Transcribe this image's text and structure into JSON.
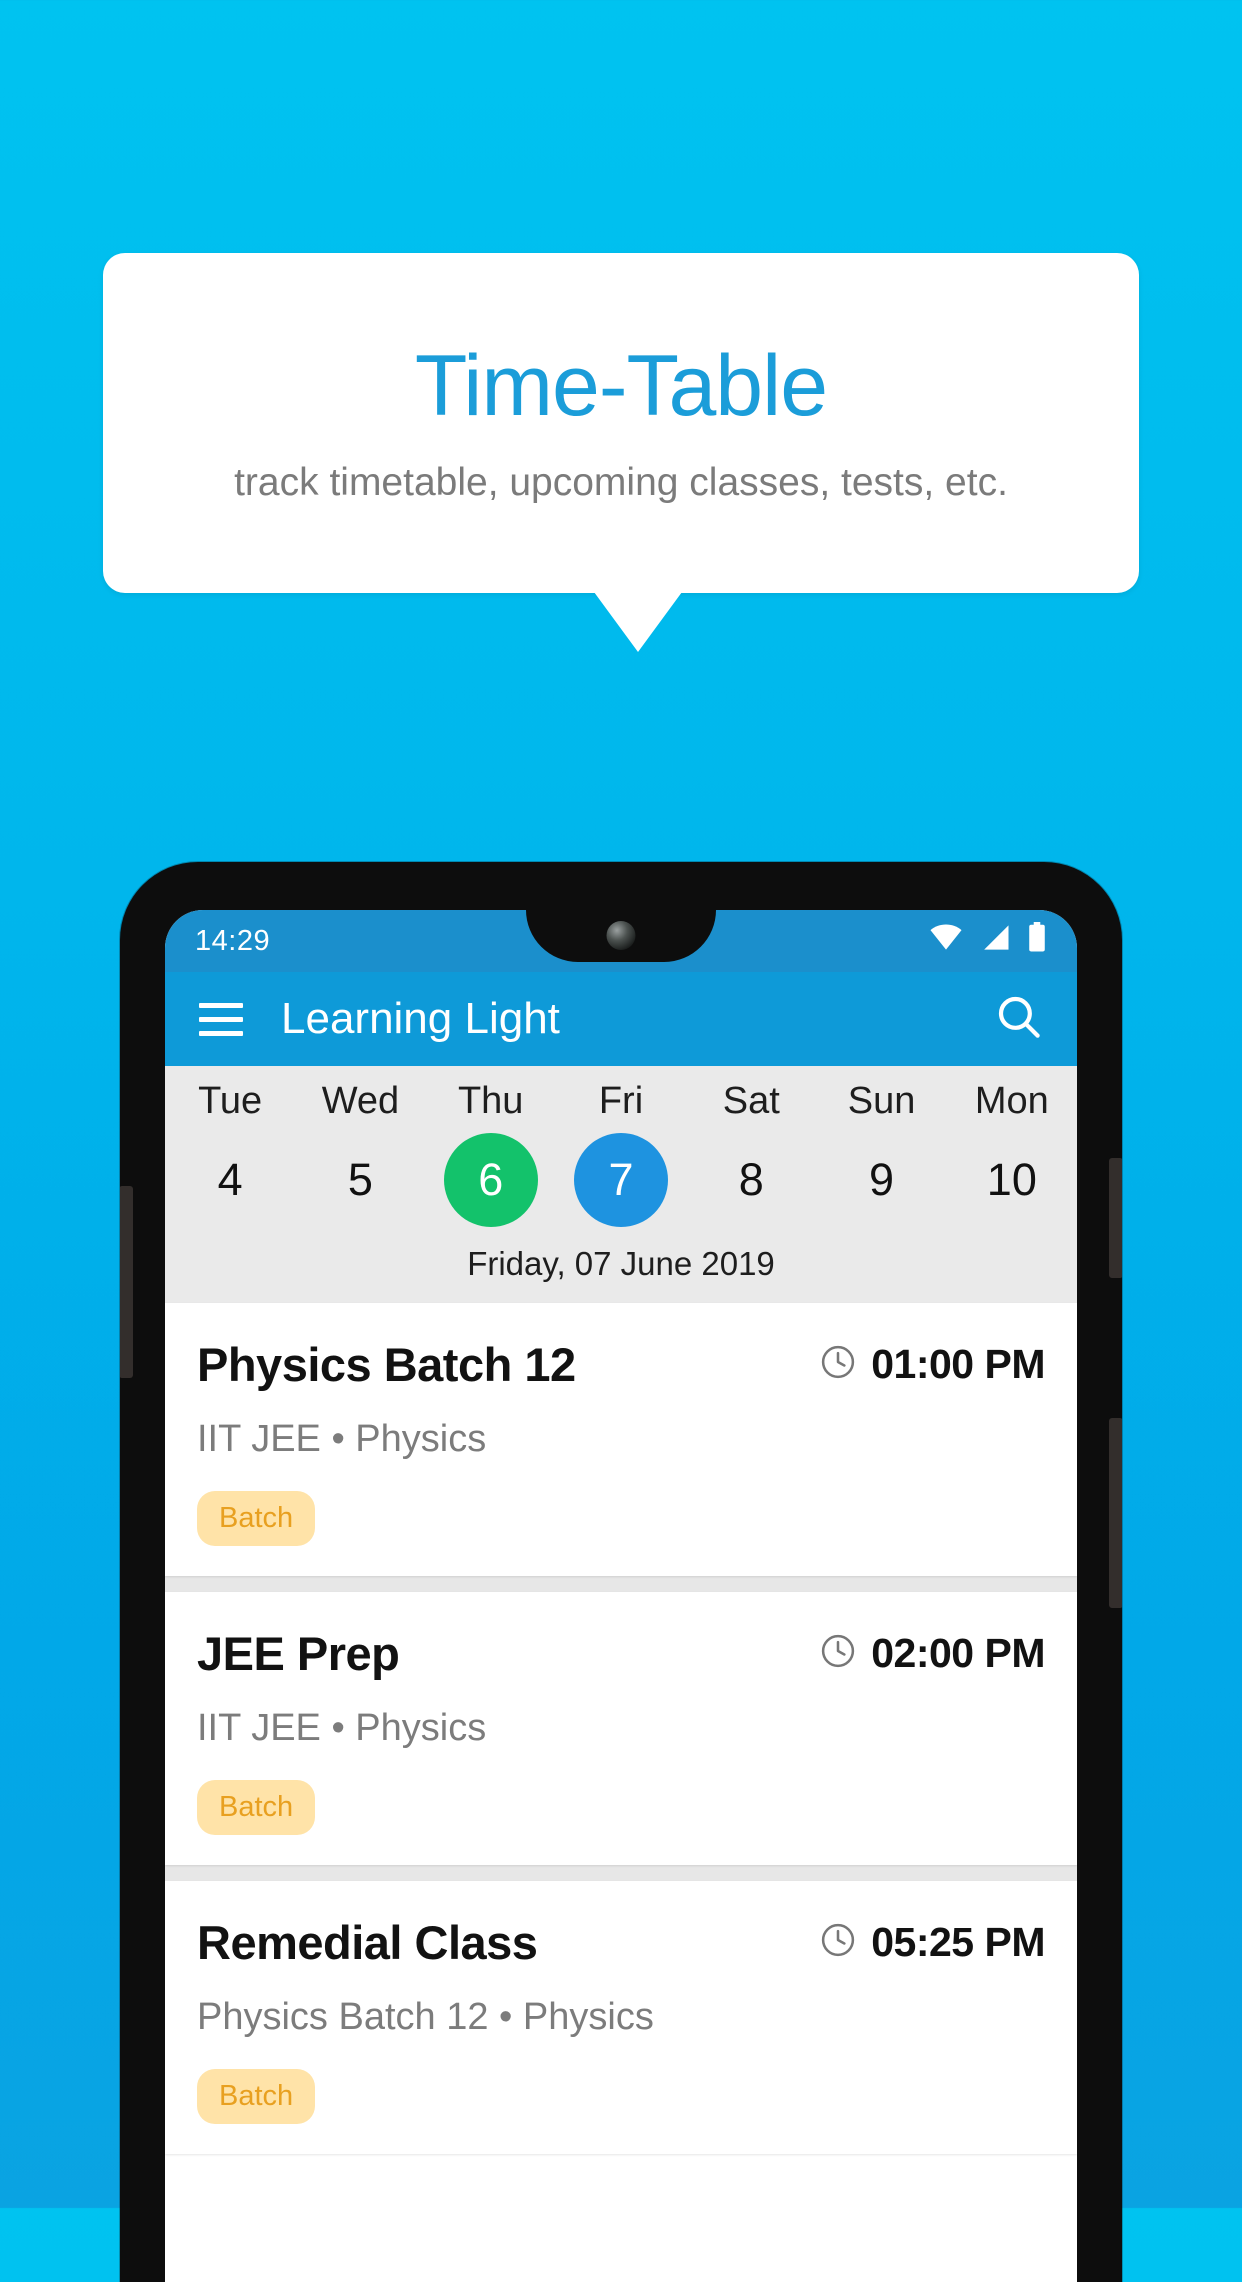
{
  "promo": {
    "title": "Time-Table",
    "subtitle": "track timetable, upcoming classes, tests, etc.",
    "title_color": "#1b9dd9",
    "background": "#00b6ec"
  },
  "phone": {
    "statusbar": {
      "time": "14:29",
      "icons": [
        "wifi-icon",
        "signal-icon",
        "battery-icon"
      ]
    },
    "appbar": {
      "menu_icon": "hamburger-menu-icon",
      "title": "Learning Light",
      "search_icon": "search-icon"
    },
    "datestrip": {
      "days": [
        {
          "name": "Tue",
          "num": "4",
          "state": "normal"
        },
        {
          "name": "Wed",
          "num": "5",
          "state": "normal"
        },
        {
          "name": "Thu",
          "num": "6",
          "state": "today"
        },
        {
          "name": "Fri",
          "num": "7",
          "state": "selected"
        },
        {
          "name": "Sat",
          "num": "8",
          "state": "normal"
        },
        {
          "name": "Sun",
          "num": "9",
          "state": "normal"
        },
        {
          "name": "Mon",
          "num": "10",
          "state": "normal"
        }
      ],
      "full_date": "Friday, 07 June 2019",
      "today_color": "#13c26b",
      "selected_color": "#1e93e0"
    },
    "classes": [
      {
        "title": "Physics Batch 12",
        "time": "01:00 PM",
        "subtitle": "IIT JEE • Physics",
        "tag": "Batch"
      },
      {
        "title": "JEE Prep",
        "time": "02:00 PM",
        "subtitle": "IIT JEE • Physics",
        "tag": "Batch"
      },
      {
        "title": "Remedial Class",
        "time": "05:25 PM",
        "subtitle": "Physics Batch 12 • Physics",
        "tag": "Batch"
      }
    ]
  }
}
